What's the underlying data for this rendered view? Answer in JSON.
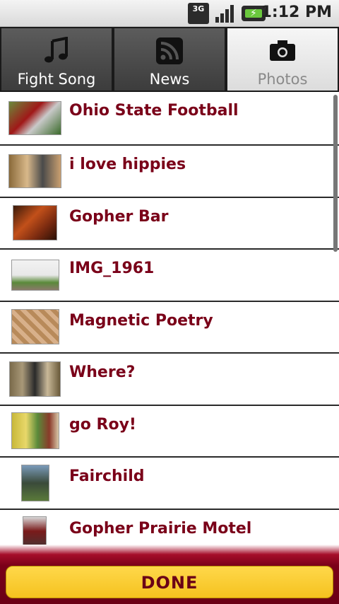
{
  "status_bar": {
    "network": "3G",
    "time": "1:12 PM"
  },
  "tabs": [
    {
      "label": "Fight Song",
      "icon": "music-note-icon",
      "active": false
    },
    {
      "label": "News",
      "icon": "rss-feed-icon",
      "active": false
    },
    {
      "label": "Photos",
      "icon": "camera-icon",
      "active": true
    }
  ],
  "photos": [
    {
      "title": "Ohio State Football"
    },
    {
      "title": "i love hippies"
    },
    {
      "title": "Gopher Bar"
    },
    {
      "title": "IMG_1961"
    },
    {
      "title": "Magnetic Poetry"
    },
    {
      "title": "Where?"
    },
    {
      "title": "go Roy!"
    },
    {
      "title": "Fairchild"
    },
    {
      "title": "Gopher Prairie Motel"
    }
  ],
  "done_button": {
    "label": "DONE"
  },
  "colors": {
    "accent_maroon": "#7a0019",
    "accent_gold": "#f5c21f"
  }
}
